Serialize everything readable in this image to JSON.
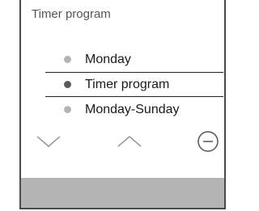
{
  "screen": {
    "title": "Timer program"
  },
  "menu": {
    "items": [
      {
        "label": "Monday",
        "selected": false
      },
      {
        "label": "Timer program",
        "selected": true
      },
      {
        "label": "Monday-Sunday",
        "selected": false
      }
    ]
  },
  "controls": {
    "down": "chevron-down-icon",
    "up": "chevron-up-icon",
    "back": "minus-circle-icon"
  },
  "colors": {
    "dot_unselected": "#b3b3b3",
    "dot_selected": "#5a5a5a",
    "footer": "#b4b4b4",
    "frame": "#4a4a4a"
  }
}
